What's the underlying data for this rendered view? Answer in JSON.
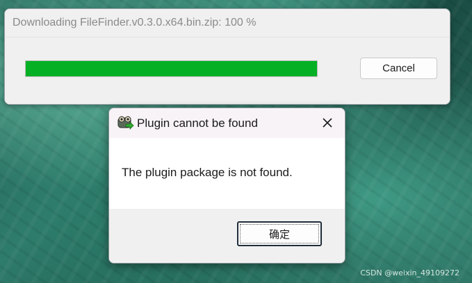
{
  "download_window": {
    "title": "Downloading FileFinder.v0.3.0.x64.bin.zip: 100 %",
    "progress": 1.0,
    "cancel_label": "Cancel"
  },
  "dialog": {
    "title": "Plugin cannot be found",
    "icon": "plugin-icon",
    "message": "The plugin package is not found.",
    "ok_label": "确定"
  },
  "watermark": "CSDN @weixin_49109272",
  "colors": {
    "progress": "#06b025",
    "window_bg": "#f0f0f0",
    "dialog_bg": "#ffffff"
  }
}
